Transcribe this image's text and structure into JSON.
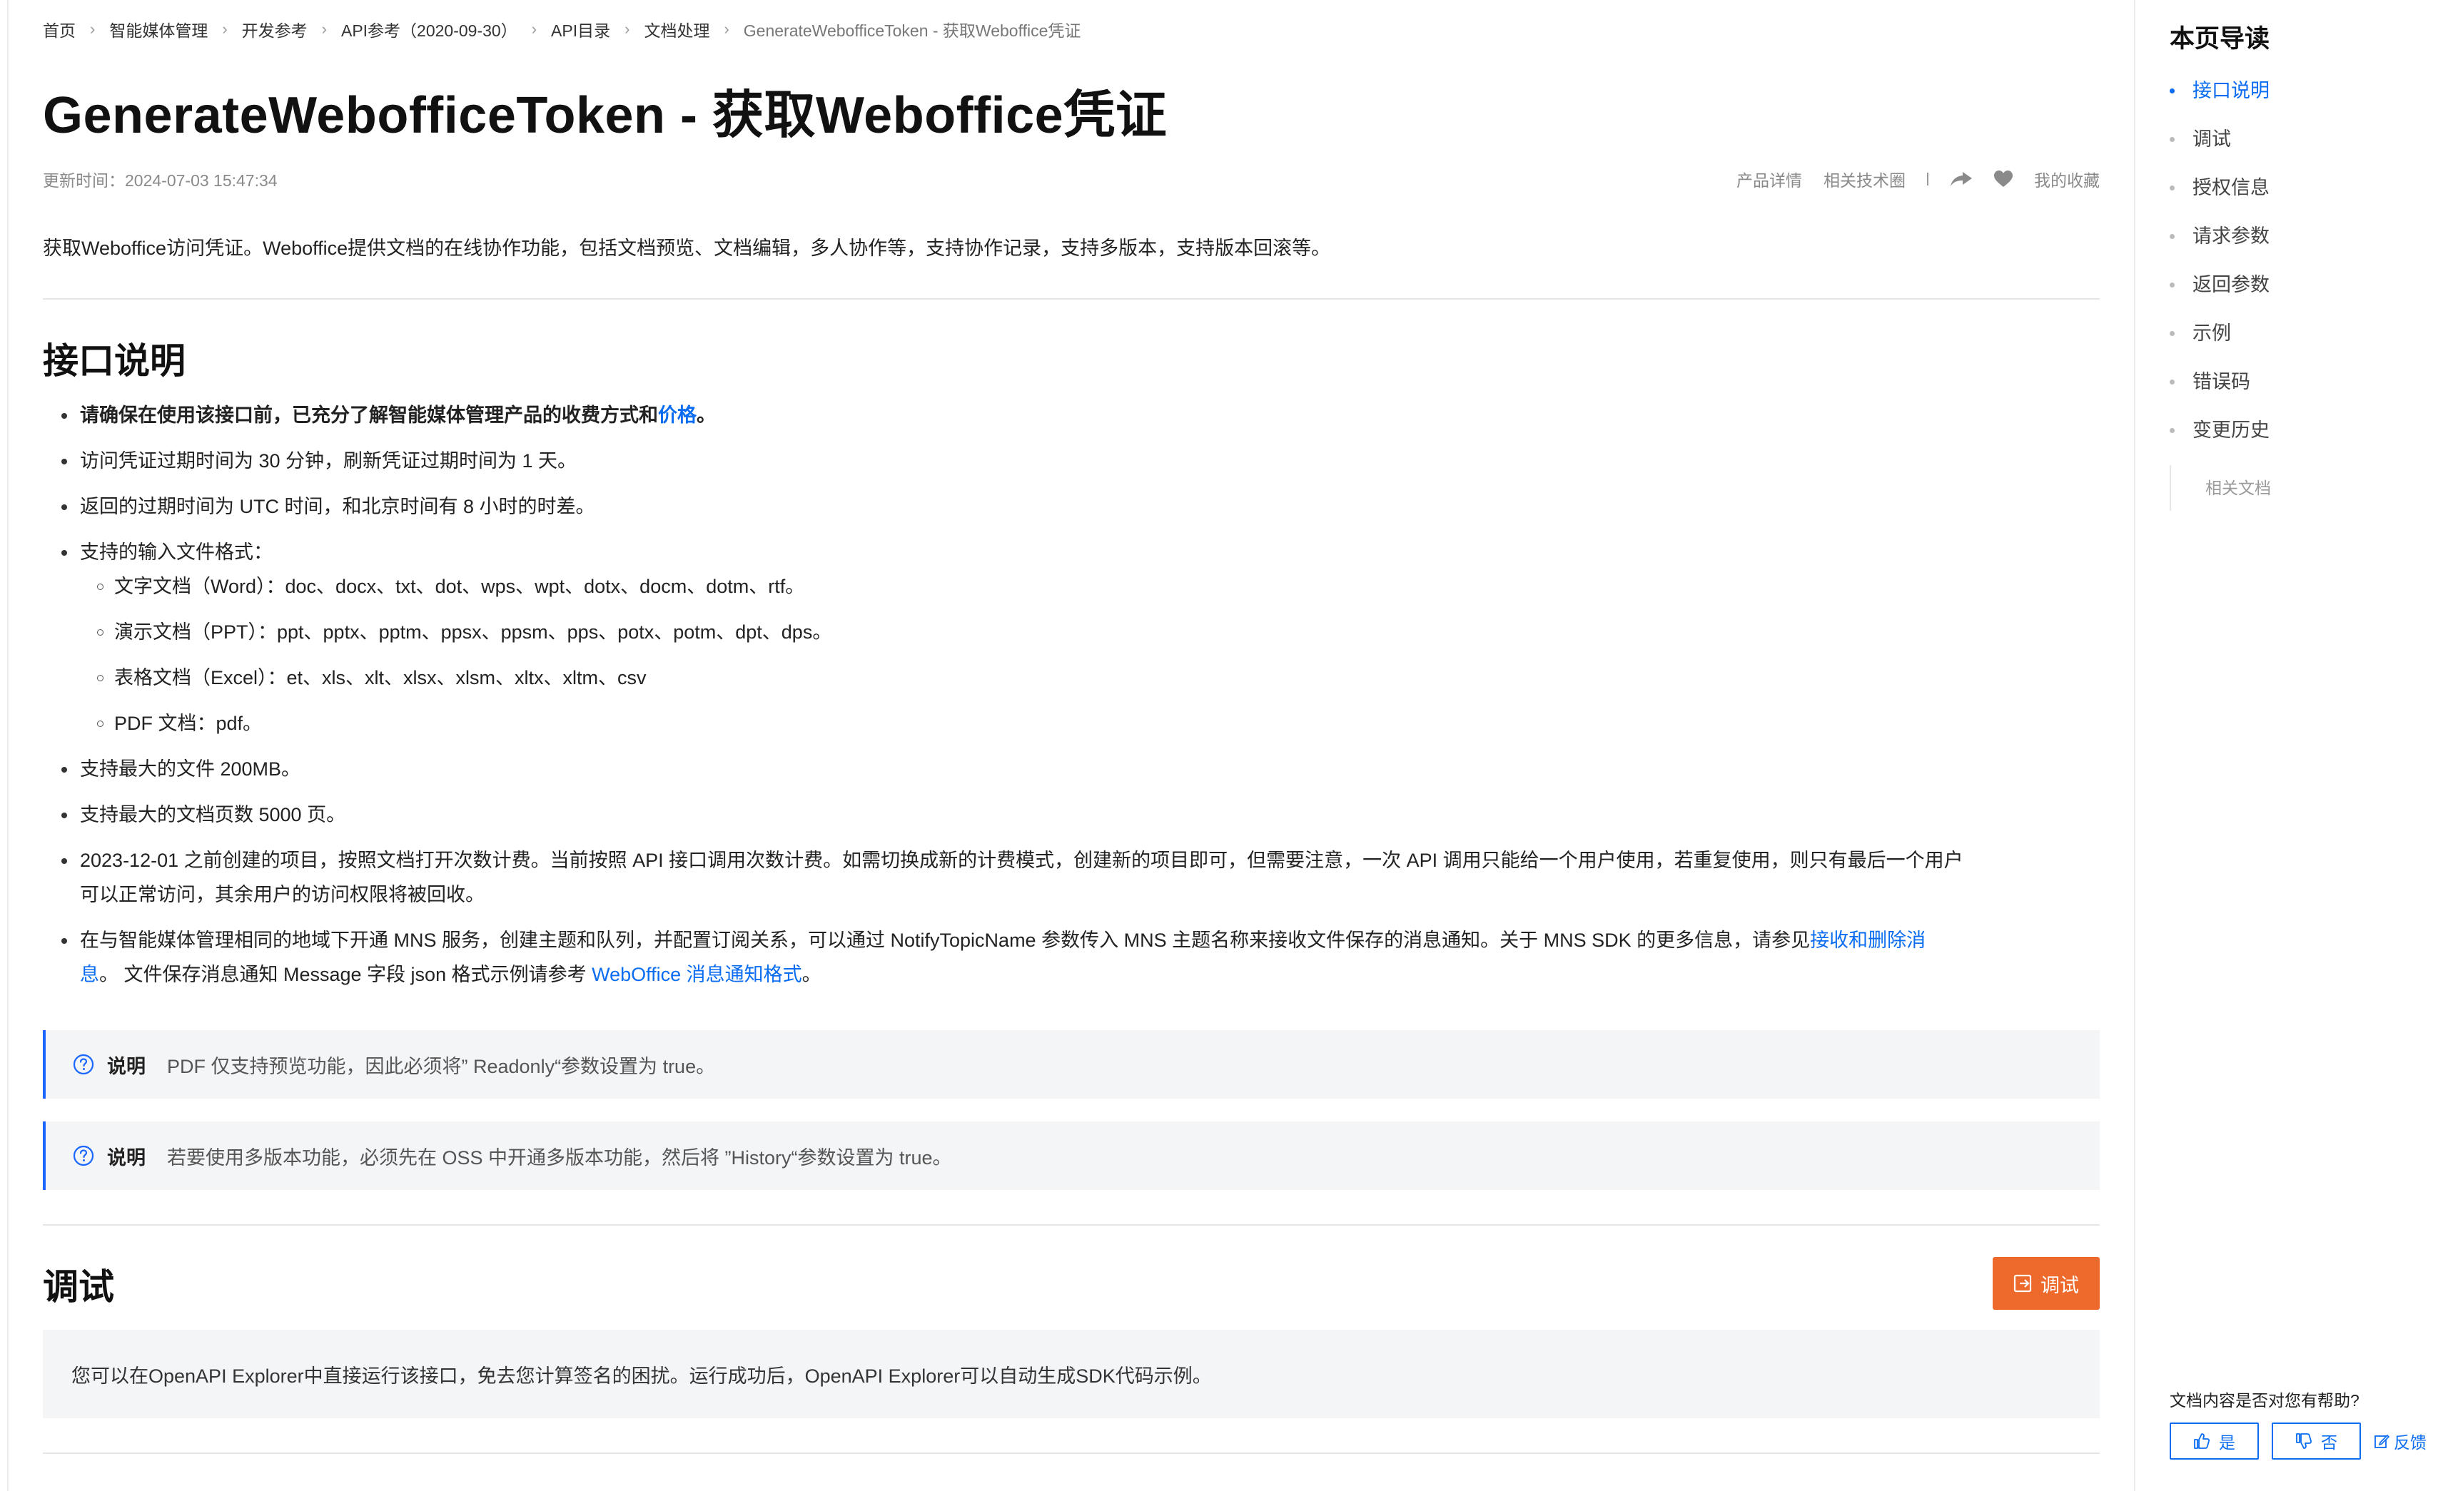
{
  "breadcrumb": [
    {
      "label": "首页"
    },
    {
      "label": "智能媒体管理"
    },
    {
      "label": "开发参考"
    },
    {
      "label": "API参考（2020-09-30）"
    },
    {
      "label": "API目录"
    },
    {
      "label": "文档处理"
    },
    {
      "label": "GenerateWebofficeToken - 获取Weboffice凭证"
    }
  ],
  "page": {
    "title": "GenerateWebofficeToken - 获取Weboffice凭证",
    "updated": "更新时间：2024-07-03 15:47:34",
    "actions": {
      "product_details": "产品详情",
      "tech_circle": "相关技术圈",
      "favorites": "我的收藏"
    },
    "intro": "获取Weboffice访问凭证。Weboffice提供文档的在线协作功能，包括文档预览、文档编辑，多人协作等，支持协作记录，支持多版本，支持版本回滚等。"
  },
  "api_desc": {
    "heading": "接口说明",
    "bullet1_text": "请确保在使用该接口前，已充分了解智能媒体管理产品的收费方式和",
    "bullet1_link": "价格",
    "bullet1_end": "。",
    "bullet2": "访问凭证过期时间为 30 分钟，刷新凭证过期时间为 1 天。",
    "bullet3": "返回的过期时间为 UTC 时间，和北京时间有 8 小时的时差。",
    "bullet4": "支持的输入文件格式：",
    "formats": [
      "文字文档（Word）：doc、docx、txt、dot、wps、wpt、dotx、docm、dotm、rtf。",
      "演示文档（PPT）：ppt、pptx、pptm、ppsx、ppsm、pps、potx、potm、dpt、dps。",
      "表格文档（Excel）：et、xls、xlt、xlsx、xlsm、xltx、xltm、csv",
      "PDF 文档：pdf。"
    ],
    "bullet5": "支持最大的文件 200MB。",
    "bullet6": "支持最大的文档页数 5000 页。",
    "bullet7_line1": "2023-12-01 之前创建的项目，按照文档打开次数计费。当前按照 API 接口调用次数计费。如需切换成新的计费模式，创建新的项目即可，但需要注意，一次 API 调用只能给一个用户使用，若重复使用，则只有最后一个用户",
    "bullet7_line2": "可以正常访问，其余用户的访问权限将被回收。",
    "bullet8_text": "在与智能媒体管理相同的地域下开通 MNS 服务，创建主题和队列，并配置订阅关系，可以通过 NotifyTopicName 参数传入 MNS 主题名称来接收文件保存的消息通知。关于 MNS SDK 的更多信息，请参见",
    "bullet8_link1a": "接收和删除消",
    "bullet8_link1b": "息",
    "bullet8_mid": "。 文件保存消息通知 Message 字段 json 格式示例请参考 ",
    "bullet8_link2": "WebOffice 消息通知格式",
    "bullet8_end": "。"
  },
  "notes": [
    {
      "label": "说明",
      "text": "PDF 仅支持预览功能，因此必须将” Readonly“参数设置为 true。"
    },
    {
      "label": "说明",
      "text": "若要使用多版本功能，必须先在 OSS 中开通多版本功能，然后将 ”History“参数设置为 true。"
    }
  ],
  "debug": {
    "heading": "调试",
    "button_label": "调试",
    "text": "您可以在OpenAPI Explorer中直接运行该接口，免去您计算签名的困扰。运行成功后，OpenAPI Explorer可以自动生成SDK代码示例。"
  },
  "toc": {
    "title": "本页导读",
    "items": [
      {
        "label": "接口说明"
      },
      {
        "label": "调试"
      },
      {
        "label": "授权信息"
      },
      {
        "label": "请求参数"
      },
      {
        "label": "返回参数"
      },
      {
        "label": "示例"
      },
      {
        "label": "错误码"
      },
      {
        "label": "变更历史"
      }
    ],
    "sub": "相关文档"
  },
  "feedback": {
    "question": "文档内容是否对您有帮助?",
    "yes": "是",
    "no": "否",
    "report": "反馈"
  },
  "colors": {
    "link": "#0a6cf0",
    "debug_button": "#ed6a2c",
    "note_border": "#1a66ff"
  }
}
